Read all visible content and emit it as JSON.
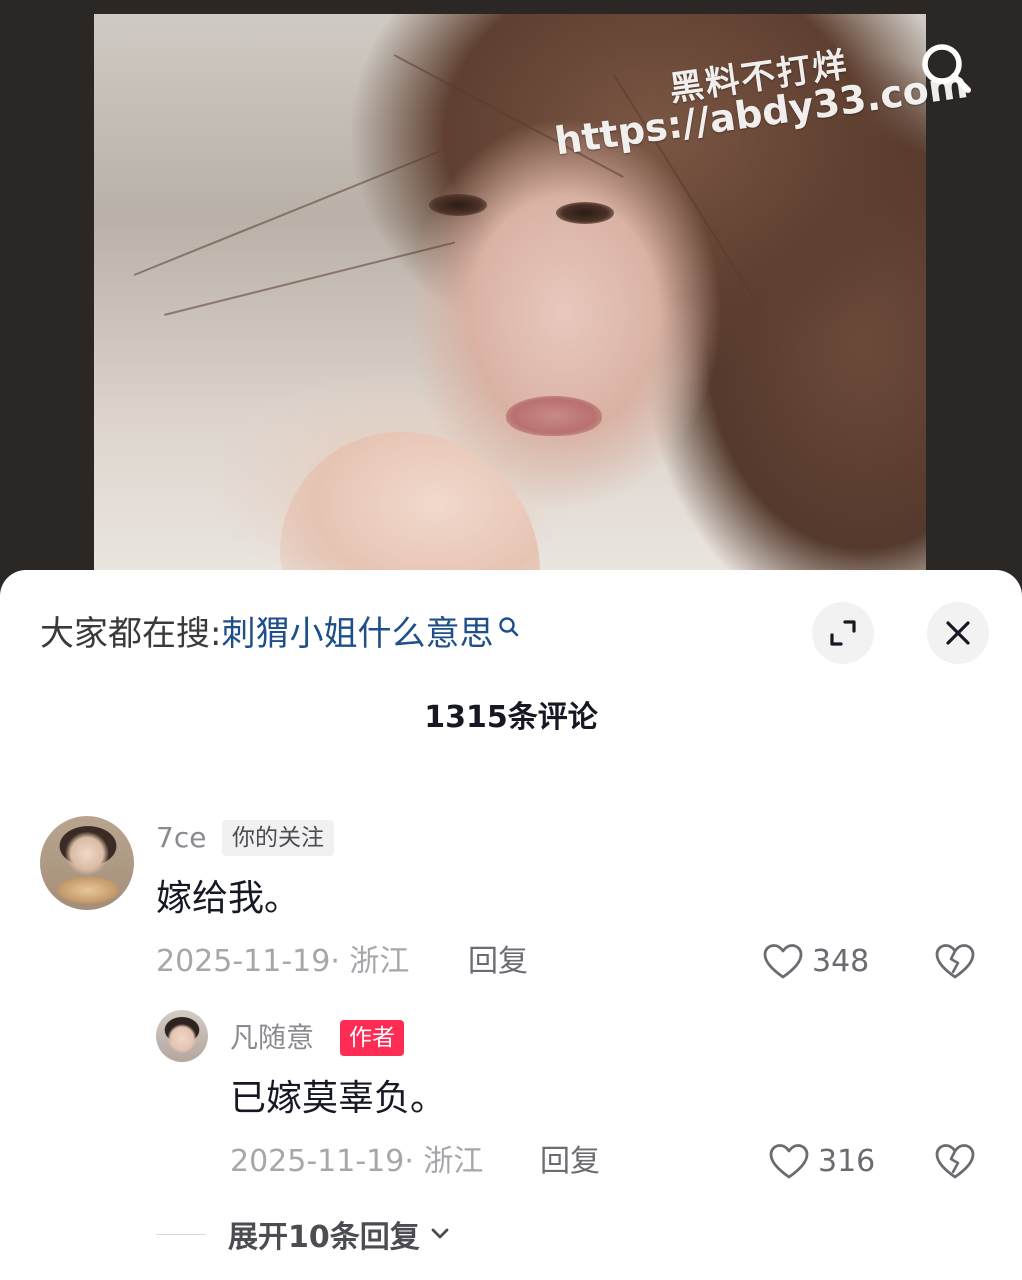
{
  "watermark": {
    "line1": "黑料不打烊",
    "line2": "https://abdy33.com"
  },
  "search_suggestion": {
    "prefix": "大家都在搜:",
    "keyword": "刺猬小姐什么意思"
  },
  "comments_header": {
    "count_label": "1315条评论"
  },
  "comments": [
    {
      "username": "7ce",
      "tag": "你的关注",
      "text": "嫁给我。",
      "meta": "2025-11-19· 浙江",
      "reply_label": "回复",
      "likes": "348"
    },
    {
      "username": "凡随意",
      "tag": "作者",
      "text": "已嫁莫辜负。",
      "meta": "2025-11-19· 浙江",
      "reply_label": "回复",
      "likes": "316"
    }
  ],
  "expand_replies": {
    "label": "展开10条回复"
  },
  "colors": {
    "keyword": "#1e4f8a",
    "author_tag": "#fe2c55",
    "muted_text": "#a6a7ab"
  },
  "icons": {
    "top_right": "search-icon",
    "expand": "expand-icon",
    "close": "close-icon",
    "like": "heart-icon",
    "dislike": "broken-heart-icon",
    "chevron": "chevron-down-icon"
  }
}
